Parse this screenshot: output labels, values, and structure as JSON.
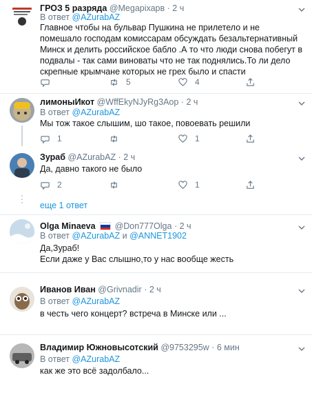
{
  "tweets": [
    {
      "name": "ГРОЗ 5 разряда",
      "handle": "@Megaріхарв",
      "time": "2 ч",
      "reply_prefix": "В ответ",
      "reply_to": "@AZurabAZ",
      "text": "Главное чтобы на бульвар Пушкина не прилетело и не помешало господам комиссарам обсуждать безальтернативный Минск и делить российское бабло .А то что люди снова побегут в подвалы - так сами виноваты что не так поднялись.То ли дело скрепные крымчане которых не грех было  и спасти",
      "reply_count": "",
      "retweet_count": "5",
      "like_count": "4"
    },
    {
      "name": "лимоныИкот",
      "handle": "@WffEkyNJyRg3Aop",
      "time": "2 ч",
      "reply_prefix": "В ответ",
      "reply_to": "@AZurabAZ",
      "text": "Мы тож такое слышим, шо такое, повоевать решили",
      "reply_count": "1",
      "retweet_count": "",
      "like_count": "1"
    },
    {
      "name": "Зураб",
      "handle": "@AZurabAZ",
      "time": "2 ч",
      "text": "Да, давно такого не было",
      "reply_count": "2",
      "retweet_count": "",
      "like_count": "1"
    },
    {
      "name": "Olga Minaeva",
      "handle": "@Don777Olga",
      "time": "2 ч",
      "reply_prefix": "В ответ",
      "reply_to": "@AZurabAZ",
      "reply_and": "и",
      "reply_to_2": "@ANNET1902",
      "text": "Да,Зураб!\nЕсли даже у Вас слышно,то у нас вообще жесть"
    },
    {
      "name": "Иванов Иван",
      "handle": "@Grivnadir",
      "time": "2 ч",
      "reply_prefix": "В ответ",
      "reply_to": "@AZurabAZ",
      "text": "в честь чего концерт? встреча в Минске или ..."
    },
    {
      "name": "Владимир Южновысотский",
      "handle": "@9753295w",
      "time": "6 мин",
      "reply_prefix": "В ответ",
      "reply_to": "@AZurabAZ",
      "text": "как же это всё задолбало..."
    }
  ],
  "more_replies": "еще 1 ответ",
  "separator": "·",
  "icons": {
    "reply": "reply-icon",
    "retweet": "retweet-icon",
    "like": "heart-icon",
    "share": "share-icon",
    "caret": "chevron-down-icon"
  },
  "colors": {
    "link": "#1b95e0",
    "muted": "#657786",
    "text": "#14171a",
    "border": "#e6ecf0"
  }
}
